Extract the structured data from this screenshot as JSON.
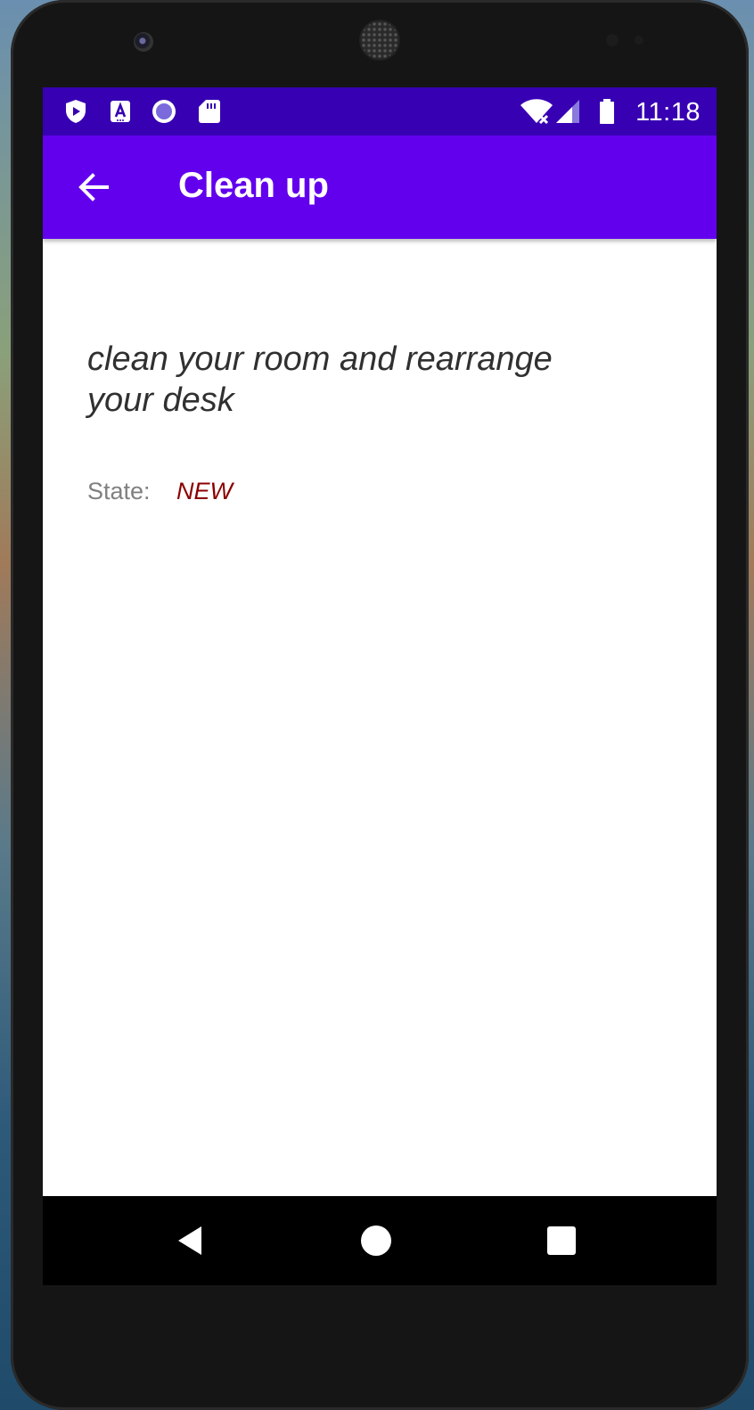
{
  "status_bar": {
    "time": "11:18",
    "icons": [
      "shield-play-icon",
      "font-a-icon",
      "circle-record-icon",
      "sd-card-icon",
      "wifi-off-icon",
      "cell-signal-icon",
      "battery-icon"
    ]
  },
  "app_bar": {
    "title": "Clean up",
    "back_icon": "arrow-back-icon",
    "color": "#6200ee"
  },
  "task": {
    "description": "clean your room and rearrange your desk",
    "state_label": "State:",
    "state_value": "NEW",
    "state_color": "#8b0000"
  },
  "nav_bar": {
    "buttons": [
      "back-triangle-icon",
      "home-circle-icon",
      "recents-square-icon"
    ]
  },
  "colors": {
    "status_bar": "#3700b3",
    "app_bar": "#6200ee"
  }
}
